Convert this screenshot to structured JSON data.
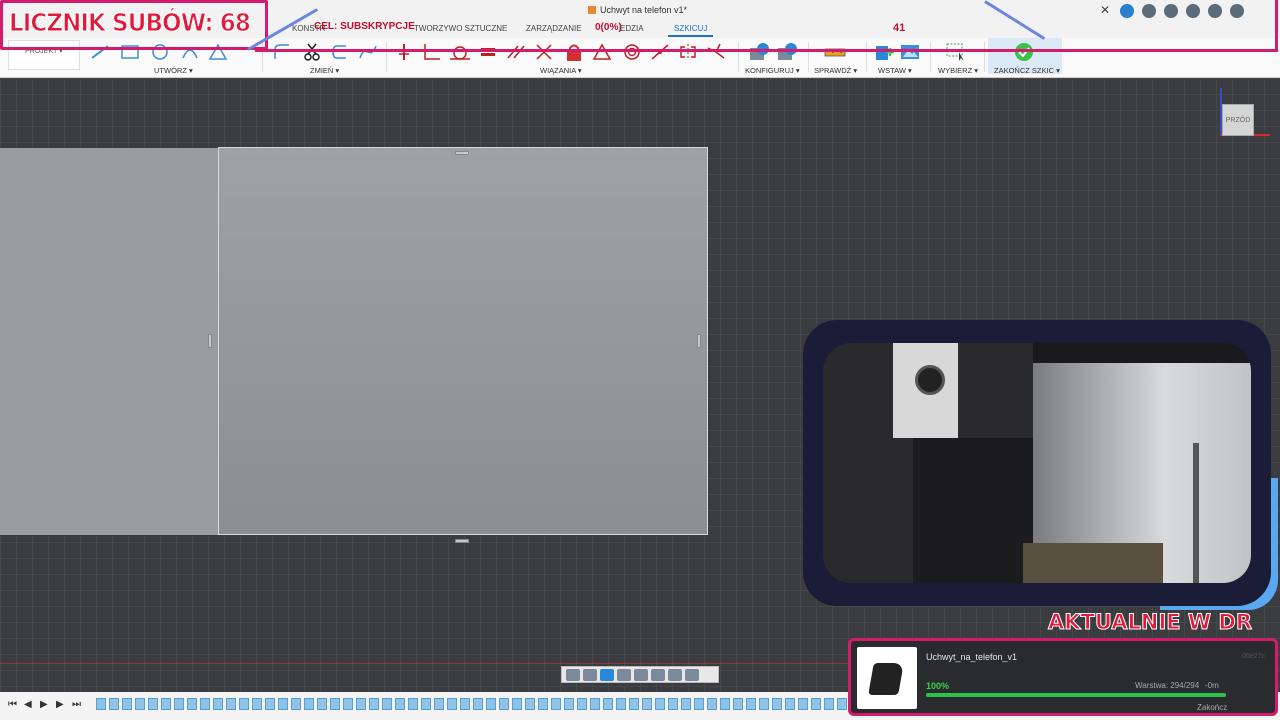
{
  "window": {
    "title": "Uchwyt na telefon v1*"
  },
  "tabs": [
    {
      "label": "KONSTR"
    },
    {
      "label": "TWORZYWO SZTUCZNE"
    },
    {
      "label": "ZARZĄDZANIE"
    },
    {
      "label": "EDZIA"
    },
    {
      "label": "SZKICUJ"
    }
  ],
  "ribbon": {
    "projekt": "PROJEKT",
    "groups": {
      "utworz": "UTWÓRZ",
      "zmien": "ZMIEŃ",
      "wiazania": "WIĄZANIA",
      "konfiguruj": "KONFIGURUJ",
      "sprawdz": "SPRAWDŹ",
      "wstaw": "WSTAW",
      "wybierz": "WYBIERZ",
      "zakoncz": "ZAKOŃCZ SZKIC"
    }
  },
  "viewcube": {
    "label": "PRZÓD"
  },
  "overlay": {
    "sub_counter": "LICZNIK SUBÓW: 68",
    "goal_label": "CEL: SUBSKRYPCJE",
    "goal_count": "0(0%)",
    "goal_number": "41",
    "aktualnie": "AKTUALNIE W DR"
  },
  "print": {
    "name": "Uchwyt_na_telefon_v1",
    "id": "00e27c",
    "percent": "100%",
    "progress": 1.0,
    "layer": "Warstwa: 294/294",
    "time": "-0m",
    "finish": "Zakończ"
  },
  "colors": {
    "accent_pink": "#d41c6c",
    "accent_red": "#e01a3a",
    "progress_green": "#2ec24a",
    "active_tab": "#1a73c8"
  }
}
